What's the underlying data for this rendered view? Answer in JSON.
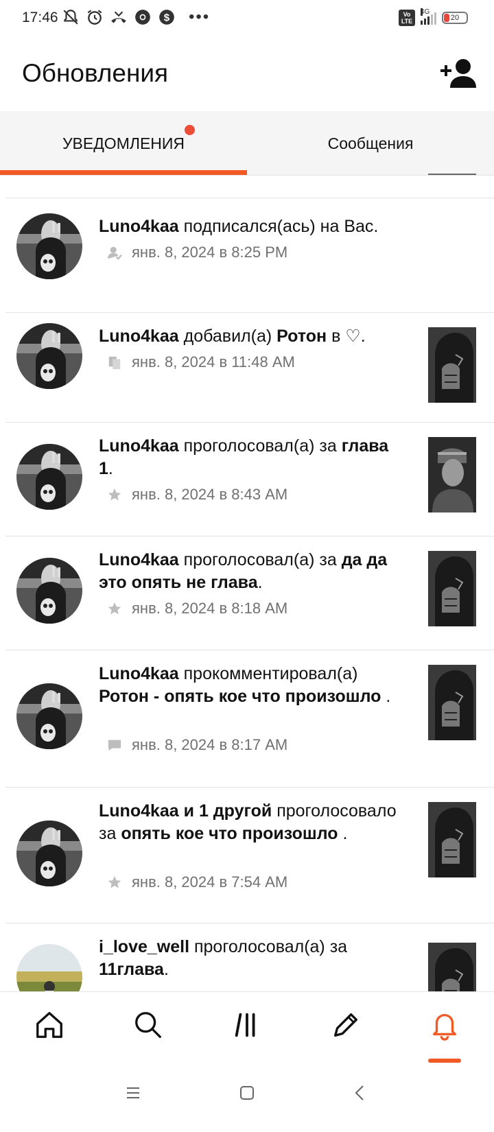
{
  "status_bar": {
    "time": "17:46",
    "volte": "Vo LTE",
    "network": "4G",
    "battery": "20"
  },
  "header": {
    "title": "Обновления"
  },
  "tabs": [
    {
      "label": "Уведомления",
      "active": true,
      "badge": true
    },
    {
      "label": "Сообщения",
      "active": false,
      "badge": false
    }
  ],
  "accent_color": "#f15a24",
  "badge_color": "#ec4d36",
  "notifications": [
    {
      "segments": [
        {
          "t": "Luno4kaa",
          "b": true
        },
        {
          "t": " подписался(ась) на Вас.",
          "b": false
        }
      ],
      "icon": "follow-icon",
      "time": "янв. 8, 2024 в 8:25 PM",
      "thumb": false
    },
    {
      "segments": [
        {
          "t": "Luno4kaa",
          "b": true
        },
        {
          "t": " добавил(а) ",
          "b": false
        },
        {
          "t": "Ротон",
          "b": true
        },
        {
          "t": " в ♡.",
          "b": false
        }
      ],
      "icon": "library-add-icon",
      "time": "янв. 8, 2024 в 11:48 AM",
      "thumb": true
    },
    {
      "segments": [
        {
          "t": "Luno4kaa",
          "b": true
        },
        {
          "t": " проголосовал(а) за ",
          "b": false
        },
        {
          "t": "глава 1",
          "b": true
        },
        {
          "t": ".",
          "b": false
        }
      ],
      "icon": "star-icon",
      "time": "янв. 8, 2024 в 8:43 AM",
      "thumb": true
    },
    {
      "segments": [
        {
          "t": "Luno4kaa",
          "b": true
        },
        {
          "t": " проголосовал(а) за ",
          "b": false
        },
        {
          "t": "да да это опять не глава",
          "b": true
        },
        {
          "t": ".",
          "b": false
        }
      ],
      "icon": "star-icon",
      "time": "янв. 8, 2024 в 8:18 AM",
      "thumb": true
    },
    {
      "segments": [
        {
          "t": "Luno4kaa",
          "b": true
        },
        {
          "t": " прокомментировал(а) ",
          "b": false
        },
        {
          "t": "Ротон - опять кое что произошло ",
          "b": true
        },
        {
          "t": ".",
          "b": false
        }
      ],
      "icon": "comment-icon",
      "time": "янв. 8, 2024 в 8:17 AM",
      "thumb": true
    },
    {
      "segments": [
        {
          "t": "Luno4kaa и 1 другой",
          "b": true
        },
        {
          "t": " проголосовало за ",
          "b": false
        },
        {
          "t": "опять кое что произошло ",
          "b": true
        },
        {
          "t": ".",
          "b": false
        }
      ],
      "icon": "star-icon",
      "time": "янв. 8, 2024 в 7:54 AM",
      "thumb": true
    },
    {
      "segments": [
        {
          "t": "i_love_well",
          "b": true
        },
        {
          "t": " проголосовал(а) за ",
          "b": false
        },
        {
          "t": "11глава",
          "b": true
        },
        {
          "t": ".",
          "b": false
        }
      ],
      "icon": "star-icon",
      "time": "",
      "thumb": true
    }
  ],
  "bottom_nav": [
    {
      "name": "home-icon",
      "active": false
    },
    {
      "name": "search-icon",
      "active": false
    },
    {
      "name": "library-icon",
      "active": false
    },
    {
      "name": "write-icon",
      "active": false
    },
    {
      "name": "bell-icon",
      "active": true
    }
  ],
  "system_nav": [
    "menu-icon",
    "home-square-icon",
    "back-icon"
  ]
}
